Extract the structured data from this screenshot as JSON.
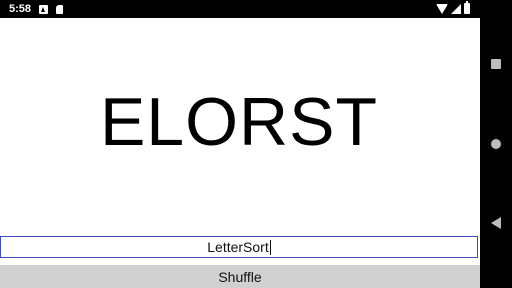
{
  "status_bar": {
    "time": "5:58"
  },
  "main": {
    "display_word": "ELORST",
    "input_value": "LetterSort",
    "shuffle_label": "Shuffle"
  },
  "icons": {
    "status": [
      "notification-a-icon",
      "sd-card-icon",
      "wifi-icon",
      "signal-icon",
      "battery-icon"
    ],
    "nav": [
      "recents-icon",
      "home-icon",
      "back-icon"
    ]
  },
  "colors": {
    "input_border": "#3f51b5",
    "button_bg": "#d0d0d0",
    "system_bars": "#000000"
  }
}
